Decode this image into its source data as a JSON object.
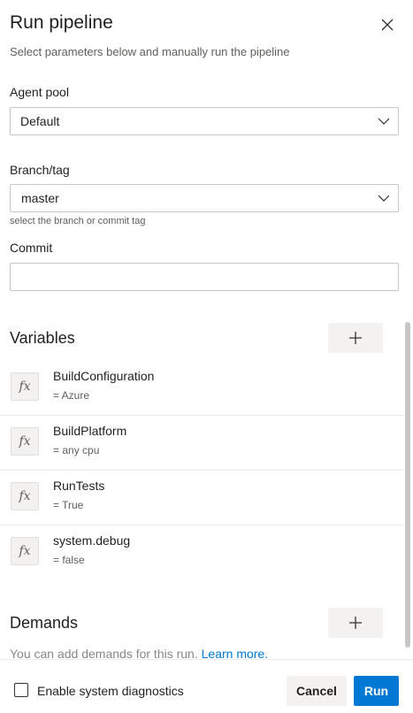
{
  "header": {
    "title": "Run pipeline",
    "subtitle": "Select parameters below and manually run the pipeline"
  },
  "agent_pool": {
    "label": "Agent pool",
    "selected": "Default"
  },
  "branch": {
    "label": "Branch/tag",
    "selected": "master",
    "help": "select the branch or commit tag"
  },
  "commit": {
    "label": "Commit",
    "value": "",
    "placeholder": ""
  },
  "variables": {
    "title": "Variables",
    "items": [
      {
        "icon": "fx-icon",
        "name": "BuildConfiguration",
        "value": "= Azure"
      },
      {
        "icon": "fx-icon",
        "name": "BuildPlatform",
        "value": "= any cpu"
      },
      {
        "icon": "fx-icon",
        "name": "RunTests",
        "value": "= True"
      },
      {
        "icon": "fx-icon",
        "name": "system.debug",
        "value": "= false"
      }
    ]
  },
  "demands": {
    "title": "Demands",
    "text": "You can add demands for this run.",
    "link": "Learn more."
  },
  "footer": {
    "diagnostics_label": "Enable system diagnostics",
    "diagnostics_checked": false,
    "cancel_label": "Cancel",
    "run_label": "Run"
  },
  "icons": {
    "fx_glyph": "fx",
    "close": "close-icon",
    "chevron": "chevron-down-icon",
    "add": "plus-icon"
  },
  "colors": {
    "primary": "#0078d4",
    "text": "#201f1e",
    "muted": "#605e5c",
    "border": "#c8c6c4",
    "button_bg": "#f3f2f1"
  }
}
